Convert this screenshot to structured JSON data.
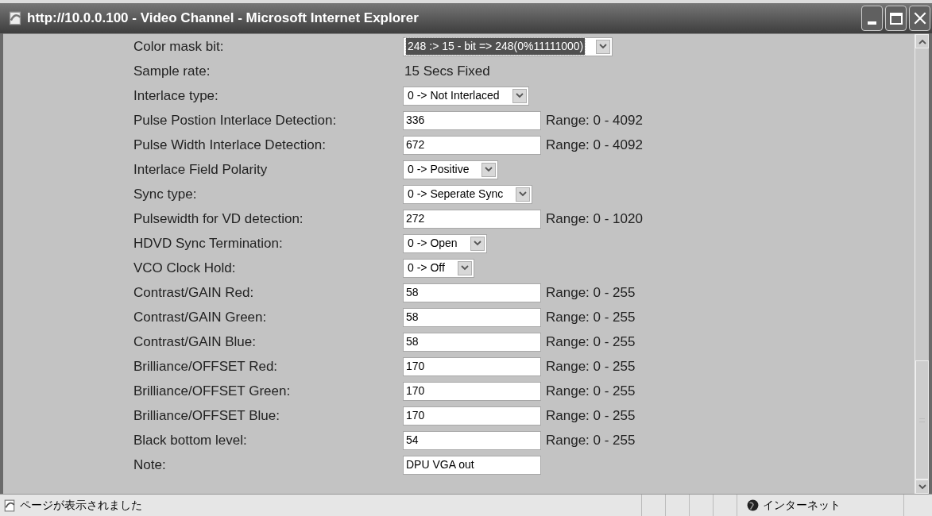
{
  "window": {
    "title": "http://10.0.0.100 - Video Channel - Microsoft Internet Explorer"
  },
  "rows": [
    {
      "label": "Color mask bit:",
      "kind": "select",
      "value": "248 :> 15 - bit => 248(0%11111000)",
      "focused": true
    },
    {
      "label": "Sample rate:",
      "kind": "text",
      "value": "15 Secs Fixed"
    },
    {
      "label": "Interlace type:",
      "kind": "select",
      "value": "0 -> Not Interlaced",
      "focused": false
    },
    {
      "label": "Pulse Postion Interlace Detection:",
      "kind": "input",
      "value": "336",
      "range": "Range: 0 - 4092"
    },
    {
      "label": "Pulse Width Interlace Detection:",
      "kind": "input",
      "value": "672",
      "range": "Range: 0 - 4092"
    },
    {
      "label": "Interlace Field Polarity",
      "kind": "select",
      "value": "0 -> Positive",
      "focused": false
    },
    {
      "label": "Sync type:",
      "kind": "select",
      "value": "0 -> Seperate Sync",
      "focused": false
    },
    {
      "label": "Pulsewidth for VD detection:",
      "kind": "input",
      "value": "272",
      "range": "Range: 0 - 1020"
    },
    {
      "label": "HDVD Sync Termination:",
      "kind": "select",
      "value": "0 -> Open",
      "focused": false
    },
    {
      "label": "VCO Clock Hold:",
      "kind": "select",
      "value": "0 -> Off",
      "focused": false
    },
    {
      "label": "Contrast/GAIN Red:",
      "kind": "input",
      "value": "58",
      "range": "Range: 0 - 255"
    },
    {
      "label": "Contrast/GAIN Green:",
      "kind": "input",
      "value": "58",
      "range": "Range: 0 - 255"
    },
    {
      "label": "Contrast/GAIN Blue:",
      "kind": "input",
      "value": "58",
      "range": "Range: 0 - 255"
    },
    {
      "label": "Brilliance/OFFSET Red:",
      "kind": "input",
      "value": "170",
      "range": "Range: 0 - 255"
    },
    {
      "label": "Brilliance/OFFSET Green:",
      "kind": "input",
      "value": "170",
      "range": "Range: 0 - 255"
    },
    {
      "label": "Brilliance/OFFSET Blue:",
      "kind": "input",
      "value": "170",
      "range": "Range: 0 - 255"
    },
    {
      "label": "Black bottom level:",
      "kind": "input",
      "value": "54",
      "range": "Range: 0 - 255"
    },
    {
      "label": "Note:",
      "kind": "input",
      "value": "DPU VGA out"
    }
  ],
  "status_bar": {
    "message": "ページが表示されました",
    "zone": "インターネット"
  }
}
